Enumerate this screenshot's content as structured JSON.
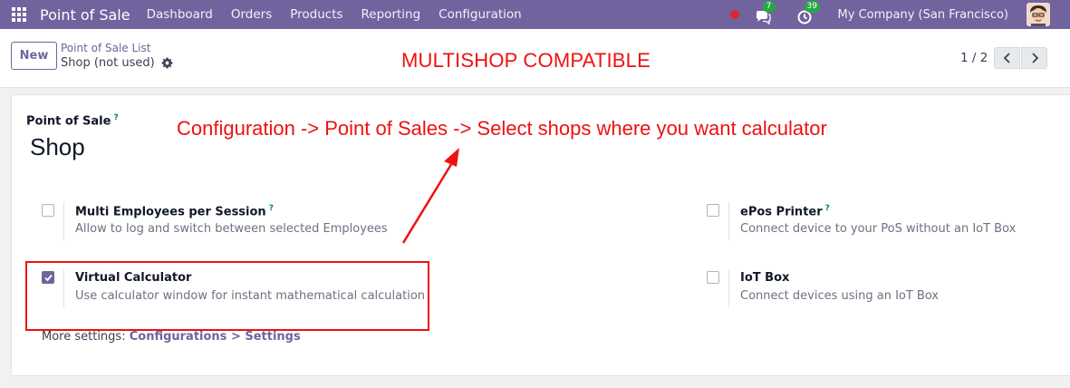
{
  "navbar": {
    "brand": "Point of Sale",
    "menu": [
      "Dashboard",
      "Orders",
      "Products",
      "Reporting",
      "Configuration"
    ],
    "messages_count": "7",
    "activities_count": "39",
    "company": "My Company (San Francisco)"
  },
  "control": {
    "new_label": "New",
    "breadcrumb": "Point of Sale List",
    "record_name": "Shop (not used)",
    "pager": "1 / 2"
  },
  "annotations": {
    "top": "MULTISHOP COMPATIBLE",
    "main": "Configuration -> Point of Sales -> Select shops where you want calculator"
  },
  "form": {
    "field_label": "Point of Sale",
    "help_mark": "?",
    "title": "Shop",
    "settings": [
      {
        "title": "Multi Employees per Session",
        "help": "?",
        "desc": "Allow to log and switch between selected Employees",
        "checked": false
      },
      {
        "title": "ePos Printer",
        "help": "?",
        "desc": "Connect device to your PoS without an IoT Box",
        "checked": false
      },
      {
        "title": "Virtual Calculator",
        "help": "",
        "desc": "Use calculator window for instant mathematical calculation",
        "checked": true
      },
      {
        "title": "IoT Box",
        "help": "",
        "desc": "Connect devices using an IoT Box",
        "checked": false
      }
    ],
    "more_settings_prefix": "More settings: ",
    "more_settings_link": "Configurations > Settings"
  },
  "colors": {
    "navbar": "#71639e",
    "accent": "#71639e",
    "annotation": "#ee1111",
    "badge": "#28a745"
  },
  "icons": {
    "apps": "apps-grid-icon",
    "record": "record-dot-icon",
    "messages": "chat-bubble-icon",
    "activities": "clock-icon",
    "gear": "gear-icon",
    "prev": "chevron-left-icon",
    "next": "chevron-right-icon",
    "check": "check-icon"
  }
}
